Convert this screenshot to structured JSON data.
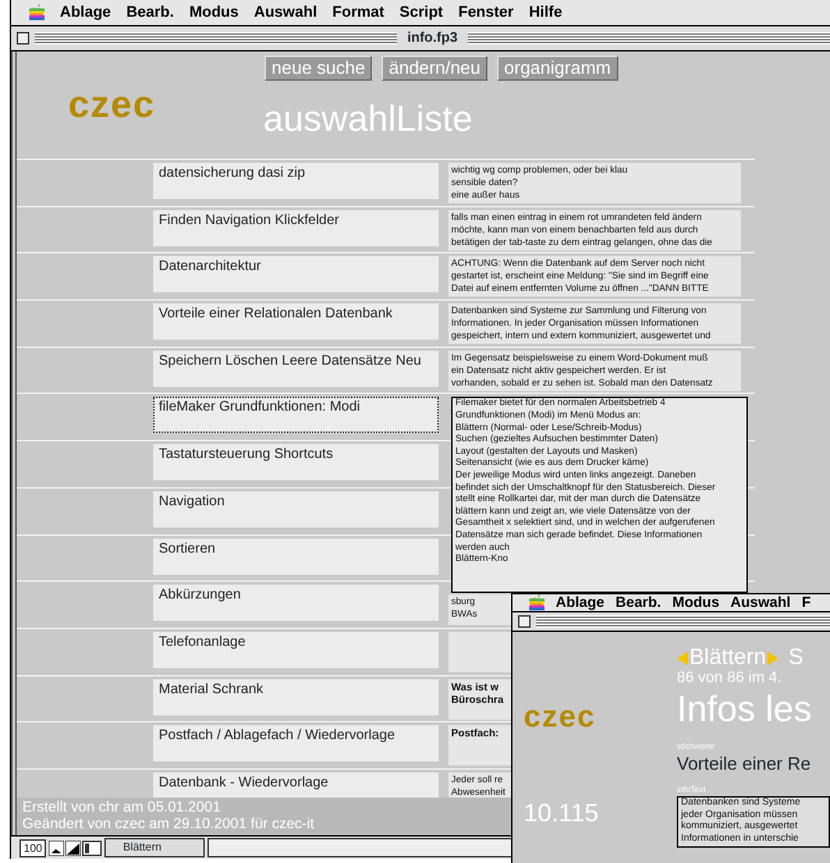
{
  "menu_bar": {
    "items": [
      "Ablage",
      "Bearb.",
      "Modus",
      "Auswahl",
      "Format",
      "Script",
      "Fenster",
      "Hilfe"
    ]
  },
  "window": {
    "title": "info.fp3"
  },
  "buttons": [
    "neue suche",
    "ändern/neu",
    "organigramm"
  ],
  "logo": "czec",
  "heading": "auswahlListe",
  "rows": [
    {
      "keyword": "datensicherung dasi zip",
      "selected": false,
      "bold": false,
      "info": [
        [
          "wichtig wg comp problemen, oder bei klau",
          "sensible daten?",
          "eine außer haus"
        ]
      ]
    },
    {
      "keyword": "Finden Navigation Klickfelder",
      "selected": false,
      "bold": false,
      "info": [
        [
          "falls man einen eintrag in einem rot umrandeten feld ändern",
          "möchte, kann man von einem benachbarten feld aus durch",
          "betätigen der tab-taste zu dem eintrag gelangen, ohne das die"
        ]
      ]
    },
    {
      "keyword": "Datenarchitektur",
      "selected": false,
      "bold": false,
      "info": [
        [
          "ACHTUNG: Wenn die Datenbank auf dem Server noch nicht",
          "gestartet ist, erscheint eine Meldung: \"Sie sind im Begriff eine",
          "Datei auf einem entfernten Volume zu öffnen ...\"DANN BITTE"
        ]
      ]
    },
    {
      "keyword": "Vorteile einer Relationalen Datenbank",
      "selected": false,
      "bold": false,
      "info": [
        [
          "Datenbanken sind Systeme zur Sammlung und Filterung von",
          "Informationen. In jeder Organisation müssen Informationen",
          "gespeichert, intern und extern kommuniziert, ausgewertet und"
        ]
      ]
    },
    {
      "keyword": "Speichern Löschen Leere Datensätze Neu",
      "selected": false,
      "bold": false,
      "info": [
        [
          "Im Gegensatz beispielsweise zu einem Word-Dokument muß",
          "ein Datensatz nicht aktiv gespeichert werden. Er ist",
          "vorhanden, sobald er zu sehen ist. Sobald man den Datensatz"
        ]
      ]
    },
    {
      "keyword": "fileMaker Grundfunktionen: Modi",
      "selected": true,
      "bold": false,
      "info": [
        [
          "Filemaker bietet für den normalen Arbeitsbetrieb 4",
          "Grundfunktionen (Modi) im Menü Modus an:"
        ],
        [
          "Blättern (Normal- oder Lese/Schreib-Modus)",
          "Suchen (gezieltes Aufsuchen bestimmter Daten)",
          "Layout (gestalten der Layouts und Masken)",
          "Seitenansicht (wie es aus dem Drucker käme)"
        ],
        [
          "Der jeweilige Modus wird unten links angezeigt. Daneben",
          "befindet sich der Umschaltknopf für den Statusbereich. Dieser",
          "stellt eine Rollkartei dar, mit der man durch die Datensätze",
          "blättern kann und zeigt an, wie viele Datensätze von der",
          "Gesamtheit x selektiert sind, und in welchen der aufgerufenen",
          "Datensätze man sich gerade befindet. Diese Informationen",
          "werden auch",
          "Blättern-Kno"
        ]
      ]
    },
    {
      "keyword": "Tastatursteuerung Shortcuts",
      "selected": false
    },
    {
      "keyword": "Navigation",
      "selected": false
    },
    {
      "keyword": "Sortieren",
      "selected": false
    },
    {
      "keyword": "Abkürzungen",
      "selected": false,
      "bold": false,
      "info": [
        [
          "sburg",
          "BWAs"
        ]
      ]
    },
    {
      "keyword": "Telefonanlage",
      "selected": false
    },
    {
      "keyword": "Material Schrank",
      "selected": false,
      "bold": true,
      "info": [
        [
          "Was ist w"
        ],
        [
          "Büroschra"
        ]
      ]
    },
    {
      "keyword": "Postfach / Ablagefach / Wiedervorlage",
      "selected": false,
      "bold": true,
      "info": [
        [
          "Postfach:"
        ]
      ]
    },
    {
      "keyword": "Datenbank - Wiedervorlage",
      "selected": false,
      "bold": false,
      "info": [
        [
          "Jeder soll re",
          "Abwesenheit"
        ]
      ]
    }
  ],
  "footer": {
    "created": "Erstellt von chr am 05.01.2001",
    "modified": "Geändert von czec am 29.10.2001 für czec-it"
  },
  "status_bar": {
    "zoom": "100",
    "mode": "Blättern"
  },
  "inset_window": {
    "menu_items": [
      "Ablage",
      "Bearb.",
      "Modus",
      "Auswahl",
      "F"
    ],
    "nav_label": "Blättern",
    "nav_tail": "S",
    "record_count": "86 von 86 im 4.",
    "heading": "Infos les",
    "logo": "czec",
    "number": "10.115",
    "keyword_label": "stichworte",
    "keyword": "Vorteile einer Re",
    "info_label": "infoText",
    "info_lines": [
      "Datenbanken sind Systeme",
      "jeder Organisation müssen",
      "kommuniziert, ausgewertet",
      "Informationen in unterschie"
    ]
  }
}
